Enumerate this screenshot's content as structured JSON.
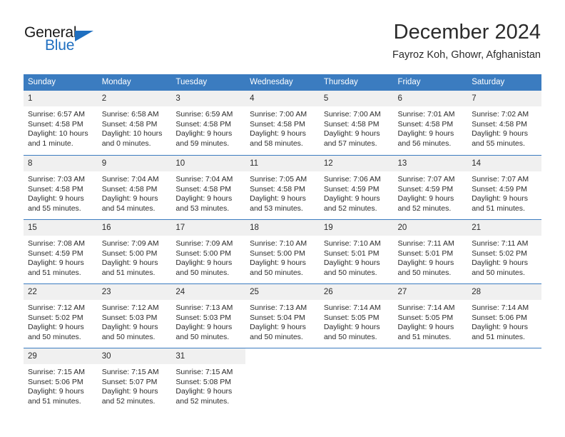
{
  "brand": {
    "name_part1": "General",
    "name_part2": "Blue",
    "triangle_icon": "triangle-icon",
    "accent_color": "#1f6fc0"
  },
  "header": {
    "month_title": "December 2024",
    "location": "Fayroz Koh, Ghowr, Afghanistan"
  },
  "theme": {
    "header_blue": "#3b7cc0",
    "daynum_gray": "#f0f0f0",
    "text": "#2b2b2b"
  },
  "calendar": {
    "weekday_headers": [
      "Sunday",
      "Monday",
      "Tuesday",
      "Wednesday",
      "Thursday",
      "Friday",
      "Saturday"
    ],
    "labels": {
      "sunrise": "Sunrise:",
      "sunset": "Sunset:",
      "daylight": "Daylight:"
    },
    "weeks": [
      [
        {
          "day": "1",
          "sunrise": "Sunrise: 6:57 AM",
          "sunset": "Sunset: 4:58 PM",
          "daylight_line1": "Daylight: 10 hours",
          "daylight_line2": "and 1 minute."
        },
        {
          "day": "2",
          "sunrise": "Sunrise: 6:58 AM",
          "sunset": "Sunset: 4:58 PM",
          "daylight_line1": "Daylight: 10 hours",
          "daylight_line2": "and 0 minutes."
        },
        {
          "day": "3",
          "sunrise": "Sunrise: 6:59 AM",
          "sunset": "Sunset: 4:58 PM",
          "daylight_line1": "Daylight: 9 hours",
          "daylight_line2": "and 59 minutes."
        },
        {
          "day": "4",
          "sunrise": "Sunrise: 7:00 AM",
          "sunset": "Sunset: 4:58 PM",
          "daylight_line1": "Daylight: 9 hours",
          "daylight_line2": "and 58 minutes."
        },
        {
          "day": "5",
          "sunrise": "Sunrise: 7:00 AM",
          "sunset": "Sunset: 4:58 PM",
          "daylight_line1": "Daylight: 9 hours",
          "daylight_line2": "and 57 minutes."
        },
        {
          "day": "6",
          "sunrise": "Sunrise: 7:01 AM",
          "sunset": "Sunset: 4:58 PM",
          "daylight_line1": "Daylight: 9 hours",
          "daylight_line2": "and 56 minutes."
        },
        {
          "day": "7",
          "sunrise": "Sunrise: 7:02 AM",
          "sunset": "Sunset: 4:58 PM",
          "daylight_line1": "Daylight: 9 hours",
          "daylight_line2": "and 55 minutes."
        }
      ],
      [
        {
          "day": "8",
          "sunrise": "Sunrise: 7:03 AM",
          "sunset": "Sunset: 4:58 PM",
          "daylight_line1": "Daylight: 9 hours",
          "daylight_line2": "and 55 minutes."
        },
        {
          "day": "9",
          "sunrise": "Sunrise: 7:04 AM",
          "sunset": "Sunset: 4:58 PM",
          "daylight_line1": "Daylight: 9 hours",
          "daylight_line2": "and 54 minutes."
        },
        {
          "day": "10",
          "sunrise": "Sunrise: 7:04 AM",
          "sunset": "Sunset: 4:58 PM",
          "daylight_line1": "Daylight: 9 hours",
          "daylight_line2": "and 53 minutes."
        },
        {
          "day": "11",
          "sunrise": "Sunrise: 7:05 AM",
          "sunset": "Sunset: 4:58 PM",
          "daylight_line1": "Daylight: 9 hours",
          "daylight_line2": "and 53 minutes."
        },
        {
          "day": "12",
          "sunrise": "Sunrise: 7:06 AM",
          "sunset": "Sunset: 4:59 PM",
          "daylight_line1": "Daylight: 9 hours",
          "daylight_line2": "and 52 minutes."
        },
        {
          "day": "13",
          "sunrise": "Sunrise: 7:07 AM",
          "sunset": "Sunset: 4:59 PM",
          "daylight_line1": "Daylight: 9 hours",
          "daylight_line2": "and 52 minutes."
        },
        {
          "day": "14",
          "sunrise": "Sunrise: 7:07 AM",
          "sunset": "Sunset: 4:59 PM",
          "daylight_line1": "Daylight: 9 hours",
          "daylight_line2": "and 51 minutes."
        }
      ],
      [
        {
          "day": "15",
          "sunrise": "Sunrise: 7:08 AM",
          "sunset": "Sunset: 4:59 PM",
          "daylight_line1": "Daylight: 9 hours",
          "daylight_line2": "and 51 minutes."
        },
        {
          "day": "16",
          "sunrise": "Sunrise: 7:09 AM",
          "sunset": "Sunset: 5:00 PM",
          "daylight_line1": "Daylight: 9 hours",
          "daylight_line2": "and 51 minutes."
        },
        {
          "day": "17",
          "sunrise": "Sunrise: 7:09 AM",
          "sunset": "Sunset: 5:00 PM",
          "daylight_line1": "Daylight: 9 hours",
          "daylight_line2": "and 50 minutes."
        },
        {
          "day": "18",
          "sunrise": "Sunrise: 7:10 AM",
          "sunset": "Sunset: 5:00 PM",
          "daylight_line1": "Daylight: 9 hours",
          "daylight_line2": "and 50 minutes."
        },
        {
          "day": "19",
          "sunrise": "Sunrise: 7:10 AM",
          "sunset": "Sunset: 5:01 PM",
          "daylight_line1": "Daylight: 9 hours",
          "daylight_line2": "and 50 minutes."
        },
        {
          "day": "20",
          "sunrise": "Sunrise: 7:11 AM",
          "sunset": "Sunset: 5:01 PM",
          "daylight_line1": "Daylight: 9 hours",
          "daylight_line2": "and 50 minutes."
        },
        {
          "day": "21",
          "sunrise": "Sunrise: 7:11 AM",
          "sunset": "Sunset: 5:02 PM",
          "daylight_line1": "Daylight: 9 hours",
          "daylight_line2": "and 50 minutes."
        }
      ],
      [
        {
          "day": "22",
          "sunrise": "Sunrise: 7:12 AM",
          "sunset": "Sunset: 5:02 PM",
          "daylight_line1": "Daylight: 9 hours",
          "daylight_line2": "and 50 minutes."
        },
        {
          "day": "23",
          "sunrise": "Sunrise: 7:12 AM",
          "sunset": "Sunset: 5:03 PM",
          "daylight_line1": "Daylight: 9 hours",
          "daylight_line2": "and 50 minutes."
        },
        {
          "day": "24",
          "sunrise": "Sunrise: 7:13 AM",
          "sunset": "Sunset: 5:03 PM",
          "daylight_line1": "Daylight: 9 hours",
          "daylight_line2": "and 50 minutes."
        },
        {
          "day": "25",
          "sunrise": "Sunrise: 7:13 AM",
          "sunset": "Sunset: 5:04 PM",
          "daylight_line1": "Daylight: 9 hours",
          "daylight_line2": "and 50 minutes."
        },
        {
          "day": "26",
          "sunrise": "Sunrise: 7:14 AM",
          "sunset": "Sunset: 5:05 PM",
          "daylight_line1": "Daylight: 9 hours",
          "daylight_line2": "and 50 minutes."
        },
        {
          "day": "27",
          "sunrise": "Sunrise: 7:14 AM",
          "sunset": "Sunset: 5:05 PM",
          "daylight_line1": "Daylight: 9 hours",
          "daylight_line2": "and 51 minutes."
        },
        {
          "day": "28",
          "sunrise": "Sunrise: 7:14 AM",
          "sunset": "Sunset: 5:06 PM",
          "daylight_line1": "Daylight: 9 hours",
          "daylight_line2": "and 51 minutes."
        }
      ],
      [
        {
          "day": "29",
          "sunrise": "Sunrise: 7:15 AM",
          "sunset": "Sunset: 5:06 PM",
          "daylight_line1": "Daylight: 9 hours",
          "daylight_line2": "and 51 minutes."
        },
        {
          "day": "30",
          "sunrise": "Sunrise: 7:15 AM",
          "sunset": "Sunset: 5:07 PM",
          "daylight_line1": "Daylight: 9 hours",
          "daylight_line2": "and 52 minutes."
        },
        {
          "day": "31",
          "sunrise": "Sunrise: 7:15 AM",
          "sunset": "Sunset: 5:08 PM",
          "daylight_line1": "Daylight: 9 hours",
          "daylight_line2": "and 52 minutes."
        },
        {
          "day": "",
          "sunrise": "",
          "sunset": "",
          "daylight_line1": "",
          "daylight_line2": ""
        },
        {
          "day": "",
          "sunrise": "",
          "sunset": "",
          "daylight_line1": "",
          "daylight_line2": ""
        },
        {
          "day": "",
          "sunrise": "",
          "sunset": "",
          "daylight_line1": "",
          "daylight_line2": ""
        },
        {
          "day": "",
          "sunrise": "",
          "sunset": "",
          "daylight_line1": "",
          "daylight_line2": ""
        }
      ]
    ]
  }
}
